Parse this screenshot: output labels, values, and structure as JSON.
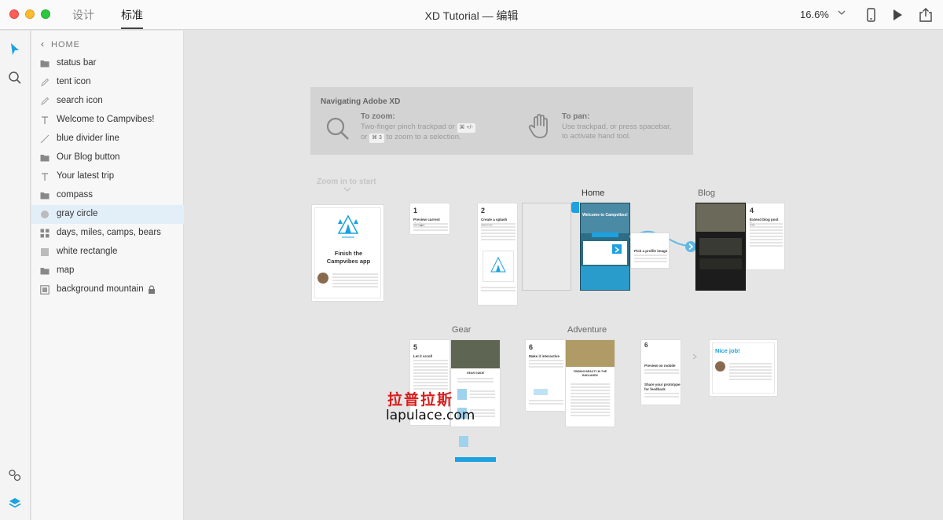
{
  "titlebar": {
    "tabs": [
      {
        "label": "设计"
      },
      {
        "label": "标准"
      }
    ],
    "title": "XD Tutorial — 编辑",
    "zoom": "16.6%"
  },
  "layers": {
    "back_label": "HOME",
    "items": [
      {
        "label": "status bar",
        "icon": "folder-icon"
      },
      {
        "label": "tent icon",
        "icon": "pen-icon"
      },
      {
        "label": "search icon",
        "icon": "pen-icon"
      },
      {
        "label": "Welcome to Campvibes!",
        "icon": "text-icon"
      },
      {
        "label": "blue divider line",
        "icon": "line-icon"
      },
      {
        "label": "Our Blog button",
        "icon": "folder-icon"
      },
      {
        "label": "Your latest trip",
        "icon": "text-icon"
      },
      {
        "label": "compass",
        "icon": "folder-icon"
      },
      {
        "label": "gray circle",
        "icon": "circle-icon"
      },
      {
        "label": "days, miles, camps, bears",
        "icon": "repeat-grid-icon"
      },
      {
        "label": "white rectangle",
        "icon": "rectangle-icon"
      },
      {
        "label": "map",
        "icon": "folder-icon"
      },
      {
        "label": "background mountain",
        "icon": "image-icon"
      }
    ],
    "selected_index": 8
  },
  "canvas": {
    "nav": {
      "title": "Navigating Adobe XD",
      "zoom_head": "To zoom:",
      "zoom_line1": "Two-finger pinch trackpad or",
      "zoom_key1": "⌘ +/-",
      "zoom_line2_pre": "or",
      "zoom_key2": "⌘ 3",
      "zoom_line2_post": "to zoom to a selection.",
      "pan_head": "To pan:",
      "pan_line1": "Use trackpad, or press spacebar,",
      "pan_line2": "to activate hand tool."
    },
    "zoom_hint": "Zoom in to start",
    "boards": {
      "home": "Home",
      "blog": "Blog",
      "gear": "Gear",
      "adventure": "Adventure"
    },
    "intro_card": {
      "title_line1": "Finish the",
      "title_line2": "Campvibes app"
    },
    "nice_job": "Nice job!",
    "step_cards": {
      "s1": {
        "num": "1",
        "head": "Preview current design"
      },
      "s2": {
        "num": "2",
        "head": "Create a splash screen"
      },
      "s3": {
        "head": "Pick a profile image"
      },
      "s4": {
        "num": "4",
        "head": "Extend blog post list"
      },
      "s5": {
        "num": "5",
        "head": "Let it scroll"
      },
      "s6": {
        "num": "6",
        "head": "Make it interactive"
      },
      "s7": {
        "num": "7",
        "head1": "Preview on mobile",
        "head2": "Share your prototype for feedback"
      }
    },
    "home_board_text": "Welcome to Campvibes!",
    "adventure_board_text": "FINDING BEAUTY IN THE BADLANDS",
    "gear_board_text": "GEAR GUIDE",
    "watermark_cn": "拉普拉斯",
    "watermark_en": "lapulace.com"
  },
  "colors": {
    "accent": "#1da1e0",
    "selected_row": "#e2eef8",
    "canvas": "#e5e5e5"
  }
}
